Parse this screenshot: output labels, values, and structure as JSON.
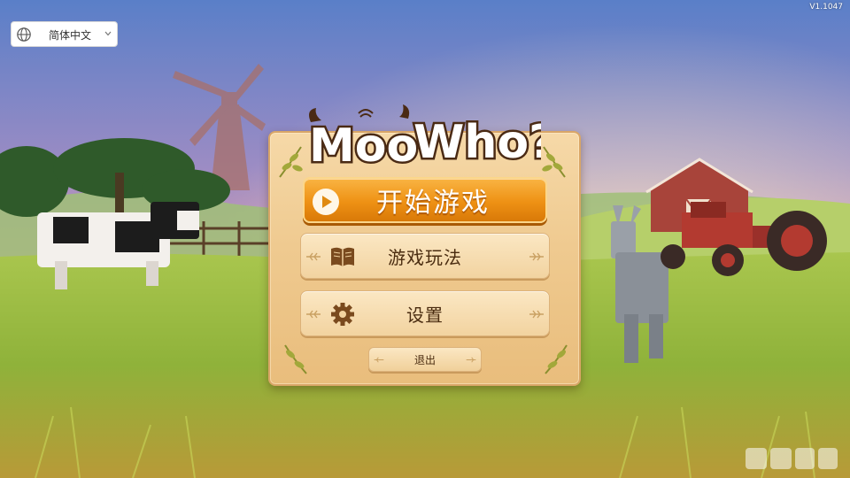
{
  "version": "V1.1047",
  "language_selector": {
    "value": "简体中文",
    "globe_icon": "globe-icon",
    "chevron_icon": "chevron-down-icon"
  },
  "logo": {
    "text": "Moo Who?"
  },
  "menu": {
    "start_label": "开始游戏",
    "start_icon": "play-icon",
    "howto_label": "游戏玩法",
    "howto_icon": "book-icon",
    "settings_label": "设置",
    "settings_icon": "gear-icon",
    "exit_label": "退出"
  },
  "colors": {
    "panel": "#efca90",
    "start_button": "#ee9114",
    "text_dark": "#4a2c10",
    "sky_top": "#5a7fc8",
    "sky_bottom": "#e8a0a8",
    "grass": "#8fb23a"
  }
}
